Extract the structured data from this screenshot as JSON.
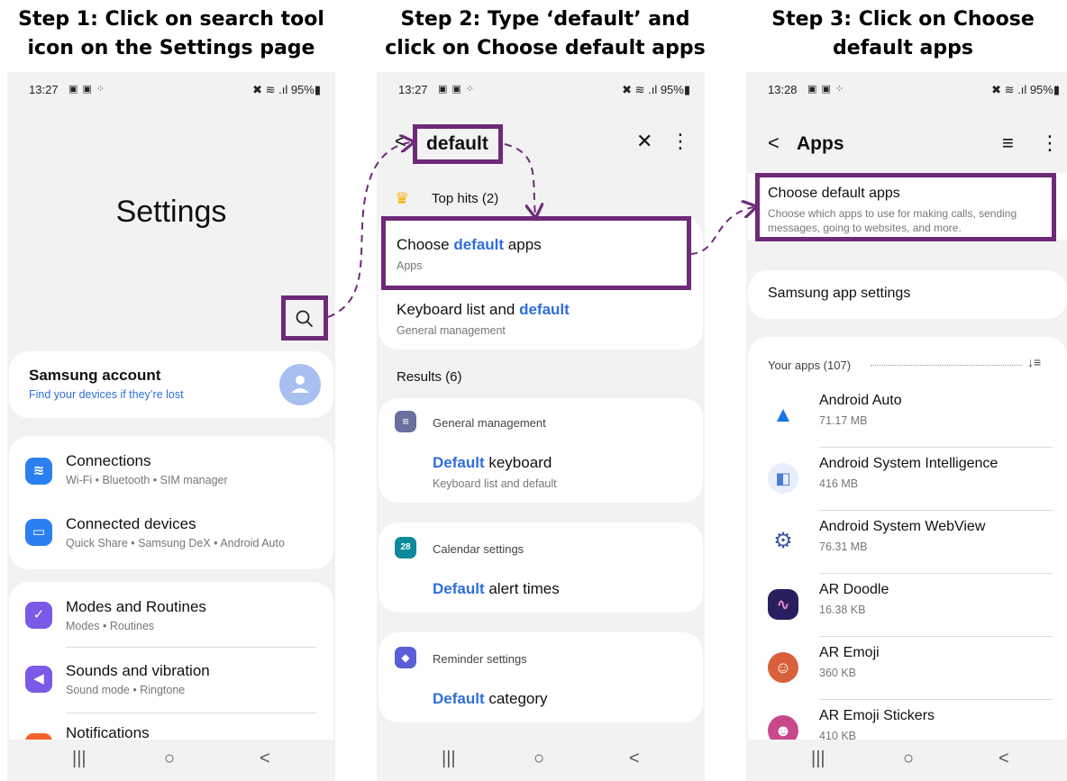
{
  "steps": [
    {
      "title_line1": "Step 1: Click on search tool",
      "title_line2": "icon on the Settings page"
    },
    {
      "title_line1": "Step 2: Type ‘default’ and",
      "title_line2": "click on Choose default apps"
    },
    {
      "title_line1": "Step 3: Click on Choose",
      "title_line2": "default apps"
    }
  ],
  "colors": {
    "highlight": "#6e2a79",
    "accent_blue": "#2f6ed8",
    "screen_bg": "#f2f2f2"
  },
  "screen1": {
    "status": {
      "time": "13:27",
      "indicators": "▣ ▣ ⁘",
      "right": "✖ ≋ .ıl 95%▮"
    },
    "page_title": "Settings",
    "search_icon": "⌕",
    "account": {
      "title": "Samsung account",
      "subtitle": "Find your devices if they’re lost"
    },
    "items": [
      {
        "title": "Connections",
        "subtitle": "Wi-Fi • Bluetooth • SIM manager",
        "icon": "wifi-icon"
      },
      {
        "title": "Connected devices",
        "subtitle": "Quick Share • Samsung DeX • Android Auto",
        "icon": "devices-icon"
      },
      {
        "title": "Modes and Routines",
        "subtitle": "Modes • Routines",
        "icon": "check-circle-icon"
      },
      {
        "title": "Sounds and vibration",
        "subtitle": "Sound mode • Ringtone",
        "icon": "speaker-icon"
      },
      {
        "title": "Notifications",
        "subtitle": "",
        "icon": "bell-icon"
      }
    ],
    "nav": {
      "recent": "|||",
      "home": "○",
      "back": "<"
    }
  },
  "screen2": {
    "status": {
      "time": "13:27",
      "indicators": "▣ ▣ ⁘",
      "right": "✖ ≋ .ıl 95%▮"
    },
    "search_value": "default",
    "back_glyph": "<",
    "close_glyph": "✕",
    "more_glyph": "⋮",
    "top_hits": "Top hits (2)",
    "hit1": {
      "pre": "Choose ",
      "accent": "default",
      "post": " apps",
      "sub": "Apps"
    },
    "hit2": {
      "pre": "Keyboard list and ",
      "accent": "default",
      "post": "",
      "sub": "General management"
    },
    "results_label": "Results (6)",
    "groups": [
      {
        "header": "General management",
        "icon_glyph": "≡",
        "accent": "Default",
        "post": " keyboard",
        "sub": "Keyboard list and default"
      },
      {
        "header": "Calendar settings",
        "icon_glyph": "28",
        "accent": "Default",
        "post": " alert times",
        "sub": ""
      },
      {
        "header": "Reminder settings",
        "icon_glyph": "◆",
        "accent": "Default",
        "post": " category",
        "sub": ""
      }
    ],
    "nav": {
      "recent": "|||",
      "home": "○",
      "back": "<"
    }
  },
  "screen3": {
    "status": {
      "time": "13:28",
      "indicators": "▣ ▣ ⁘",
      "right": "✖ ≋ .ıl 95%▮"
    },
    "back_glyph": "<",
    "title": "Apps",
    "filter_glyph": "≡",
    "more_glyph": "⋮",
    "default_apps": {
      "title": "Choose default apps",
      "sub1": "Choose which apps to use for making calls, sending",
      "sub2": "messages, going to websites, and more."
    },
    "samsung_settings": "Samsung app settings",
    "your_apps": "Your apps (107)",
    "sort_glyph": "↓≡",
    "apps": [
      {
        "name": "Android Auto",
        "size": "71.17 MB",
        "icon": "android-auto-icon",
        "color": "#1a73e8"
      },
      {
        "name": "Android System Intelligence",
        "size": "416 MB",
        "icon": "system-intelligence-icon",
        "color": "#4a7bd8"
      },
      {
        "name": "Android System WebView",
        "size": "76.31 MB",
        "icon": "webview-gear-icon",
        "color": "#3b5a9a"
      },
      {
        "name": "AR Doodle",
        "size": "16.38 KB",
        "icon": "ar-doodle-icon",
        "color": "#2a1f5e"
      },
      {
        "name": "AR Emoji",
        "size": "360 KB",
        "icon": "ar-emoji-icon",
        "color": "#d9603a"
      },
      {
        "name": "AR Emoji Stickers",
        "size": "410 KB",
        "icon": "ar-emoji-stickers-icon",
        "color": "#c9488a"
      }
    ],
    "nav": {
      "recent": "|||",
      "home": "○",
      "back": "<"
    }
  }
}
